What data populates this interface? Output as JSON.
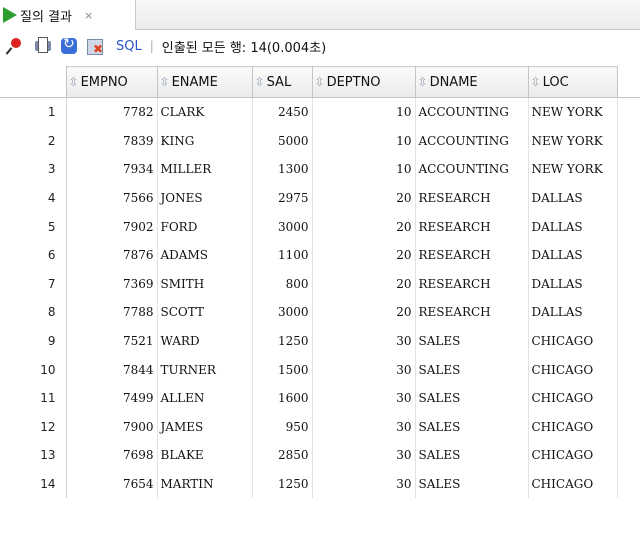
{
  "tab": {
    "title": "질의 결과",
    "close": "×"
  },
  "toolbar": {
    "sql_label": "SQL",
    "separator": "|",
    "status": "인출된 모든 행: 14(0.004초)"
  },
  "table": {
    "columns": [
      "EMPNO",
      "ENAME",
      "SAL",
      "DEPTNO",
      "DNAME",
      "LOC"
    ],
    "rows": [
      [
        "1",
        "7782",
        "CLARK",
        "2450",
        "10",
        "ACCOUNTING",
        "NEW YORK"
      ],
      [
        "2",
        "7839",
        "KING",
        "5000",
        "10",
        "ACCOUNTING",
        "NEW YORK"
      ],
      [
        "3",
        "7934",
        "MILLER",
        "1300",
        "10",
        "ACCOUNTING",
        "NEW YORK"
      ],
      [
        "4",
        "7566",
        "JONES",
        "2975",
        "20",
        "RESEARCH",
        "DALLAS"
      ],
      [
        "5",
        "7902",
        "FORD",
        "3000",
        "20",
        "RESEARCH",
        "DALLAS"
      ],
      [
        "6",
        "7876",
        "ADAMS",
        "1100",
        "20",
        "RESEARCH",
        "DALLAS"
      ],
      [
        "7",
        "7369",
        "SMITH",
        "800",
        "20",
        "RESEARCH",
        "DALLAS"
      ],
      [
        "8",
        "7788",
        "SCOTT",
        "3000",
        "20",
        "RESEARCH",
        "DALLAS"
      ],
      [
        "9",
        "7521",
        "WARD",
        "1250",
        "30",
        "SALES",
        "CHICAGO"
      ],
      [
        "10",
        "7844",
        "TURNER",
        "1500",
        "30",
        "SALES",
        "CHICAGO"
      ],
      [
        "11",
        "7499",
        "ALLEN",
        "1600",
        "30",
        "SALES",
        "CHICAGO"
      ],
      [
        "12",
        "7900",
        "JAMES",
        "950",
        "30",
        "SALES",
        "CHICAGO"
      ],
      [
        "13",
        "7698",
        "BLAKE",
        "2850",
        "30",
        "SALES",
        "CHICAGO"
      ],
      [
        "14",
        "7654",
        "MARTIN",
        "1250",
        "30",
        "SALES",
        "CHICAGO"
      ]
    ]
  },
  "icons": [
    "pin-icon",
    "print-icon",
    "refresh-icon",
    "cancel-icon",
    "sort-icon",
    "play-icon"
  ],
  "colors": {
    "accent_link": "#2b55c8",
    "play_green": "#2e9e2e"
  }
}
